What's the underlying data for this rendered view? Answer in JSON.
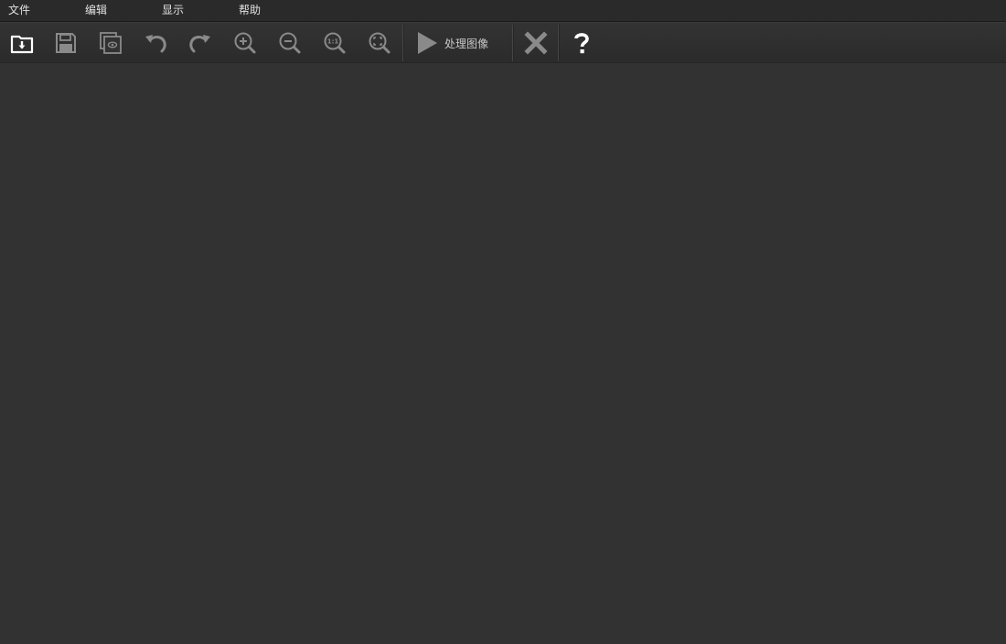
{
  "menu": {
    "file": "文件",
    "edit": "编辑",
    "view": "显示",
    "help": "帮助"
  },
  "toolbar": {
    "open": "folder-download-icon",
    "save": "save-icon",
    "preview": "preview-layers-icon",
    "undo": "undo-icon",
    "redo": "redo-icon",
    "zoom_in": "zoom-in-icon",
    "zoom_out": "zoom-out-icon",
    "zoom_actual": "zoom-actual-size-icon",
    "zoom_fit": "zoom-fit-icon",
    "process_label": "处理图像",
    "close": "close-icon",
    "help": "help-icon",
    "zoom_actual_text": "1:1"
  },
  "colors": {
    "background": "#323232",
    "menubar": "#2a2a2a",
    "icon": "#8a8a8a",
    "icon_bright": "#ffffff"
  }
}
